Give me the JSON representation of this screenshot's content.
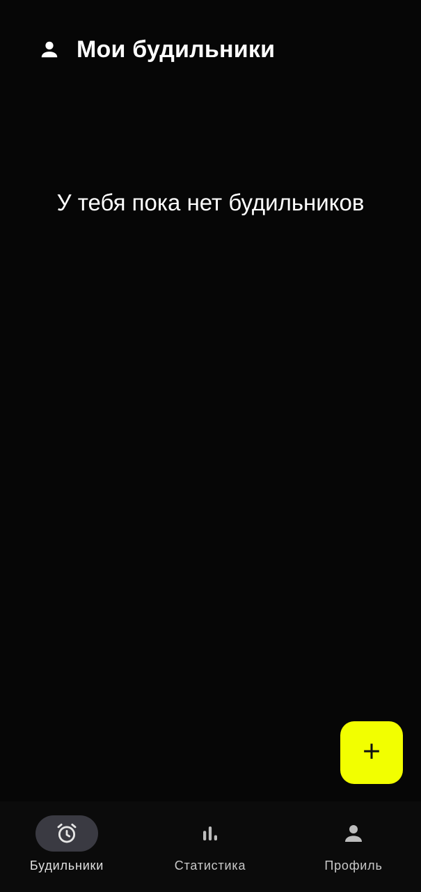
{
  "header": {
    "icon": "person-icon",
    "title": "Мои будильники"
  },
  "main": {
    "empty_message": "У тебя пока нет будильников"
  },
  "fab": {
    "icon": "plus-icon",
    "color": "#f2ff00"
  },
  "bottom_nav": {
    "items": [
      {
        "label": "Будильники",
        "icon": "alarm-clock-icon",
        "active": true
      },
      {
        "label": "Статистика",
        "icon": "bar-chart-icon",
        "active": false
      },
      {
        "label": "Профиль",
        "icon": "person-icon",
        "active": false
      }
    ]
  },
  "colors": {
    "background": "#060606",
    "accent": "#f2ff00",
    "active_pill": "#3a3a42"
  }
}
